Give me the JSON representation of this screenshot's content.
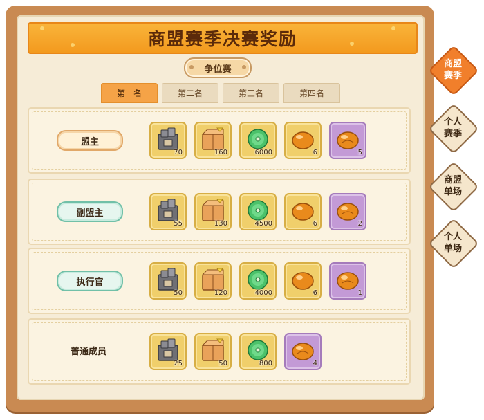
{
  "header": {
    "title": "商盟赛季决赛奖励"
  },
  "mode": {
    "label": "争位赛"
  },
  "tabs": [
    {
      "label": "第一名",
      "active": true
    },
    {
      "label": "第二名",
      "active": false
    },
    {
      "label": "第三名",
      "active": false
    },
    {
      "label": "第四名",
      "active": false
    }
  ],
  "rows": [
    {
      "role": "盟主",
      "rewards": [
        {
          "icon": "iron-chest-icon",
          "qty": "70"
        },
        {
          "icon": "wooden-crate-icon",
          "qty": "160"
        },
        {
          "icon": "jade-coin-icon",
          "qty": "6000"
        },
        {
          "icon": "amber-stone-icon",
          "qty": "6"
        },
        {
          "icon": "amber-stone-rare-icon",
          "qty": "5"
        }
      ]
    },
    {
      "role": "副盟主",
      "rewards": [
        {
          "icon": "iron-chest-icon",
          "qty": "55"
        },
        {
          "icon": "wooden-crate-icon",
          "qty": "130"
        },
        {
          "icon": "jade-coin-icon",
          "qty": "4500"
        },
        {
          "icon": "amber-stone-icon",
          "qty": "6"
        },
        {
          "icon": "amber-stone-rare-icon",
          "qty": "2"
        }
      ]
    },
    {
      "role": "执行官",
      "rewards": [
        {
          "icon": "iron-chest-icon",
          "qty": "50"
        },
        {
          "icon": "wooden-crate-icon",
          "qty": "120"
        },
        {
          "icon": "jade-coin-icon",
          "qty": "4000"
        },
        {
          "icon": "amber-stone-icon",
          "qty": "6"
        },
        {
          "icon": "amber-stone-rare-icon",
          "qty": "1"
        }
      ]
    },
    {
      "role": "普通成员",
      "rewards": [
        {
          "icon": "iron-chest-icon",
          "qty": "25"
        },
        {
          "icon": "wooden-crate-icon",
          "qty": "50"
        },
        {
          "icon": "jade-coin-icon",
          "qty": "800"
        },
        {
          "icon": "amber-stone-rare-icon",
          "qty": "4"
        }
      ]
    }
  ],
  "side_tabs": [
    {
      "label": "商盟赛季",
      "active": true
    },
    {
      "label": "个人赛季",
      "active": false
    },
    {
      "label": "商盟单场",
      "active": false
    },
    {
      "label": "个人单场",
      "active": false
    }
  ],
  "colors": {
    "accent": "#f39a1e",
    "active_tab": "#f5a347",
    "side_active": "#f17f2b",
    "rare_item": "#c39ad6"
  }
}
